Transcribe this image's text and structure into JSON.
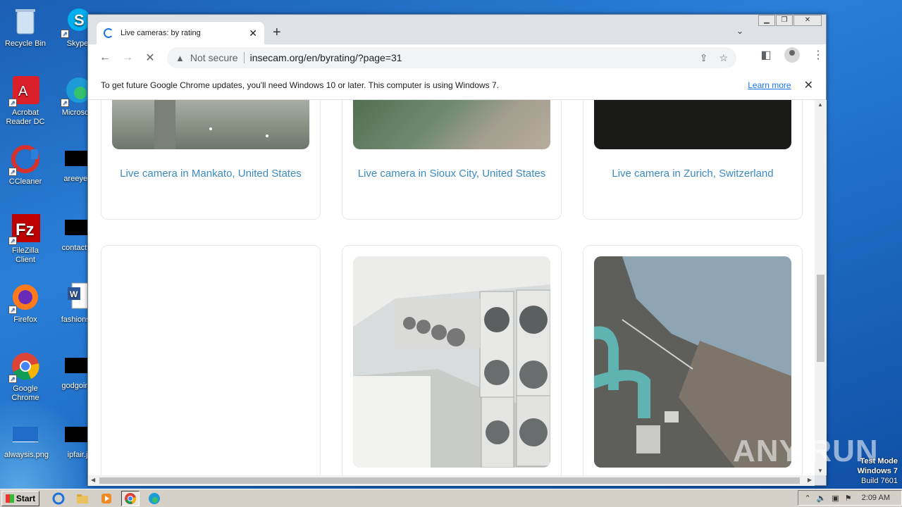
{
  "desktop": {
    "icons": [
      {
        "label": "Recycle Bin"
      },
      {
        "label": "Skype"
      },
      {
        "label": "Acrobat Reader DC"
      },
      {
        "label": "Microsoft"
      },
      {
        "label": "CCleaner"
      },
      {
        "label": "areeyes"
      },
      {
        "label": "FileZilla Client"
      },
      {
        "label": "contactfri"
      },
      {
        "label": "Firefox"
      },
      {
        "label": "fashionsy"
      },
      {
        "label": "Google Chrome"
      },
      {
        "label": "godgoing"
      },
      {
        "label": "alwaysis.png"
      },
      {
        "label": "ipfair.j"
      }
    ]
  },
  "browser": {
    "tab_title": "Live cameras: by rating",
    "new_tab": "+",
    "address": {
      "security_label": "Not secure",
      "url": "insecam.org/en/byrating/?page=31"
    },
    "infobar": {
      "message": "To get future Google Chrome updates, you'll need Windows 10 or later. This computer is using Windows 7.",
      "link": "Learn more"
    }
  },
  "page": {
    "cards_row1": [
      {
        "caption": "Live camera in Mankato, United States"
      },
      {
        "caption": "Live camera in Sioux City, United States"
      },
      {
        "caption": "Live camera in Zurich, Switzerland"
      }
    ]
  },
  "taskbar": {
    "start_label": "Start",
    "clock": "2:09 AM"
  },
  "overlay": {
    "test_mode": "Test Mode",
    "os": "Windows 7",
    "build": "Build 7601",
    "watermark": "ANY RUN"
  },
  "colors": {
    "link": "#3b8bc2",
    "chrome_accent": "#1a73e8"
  }
}
